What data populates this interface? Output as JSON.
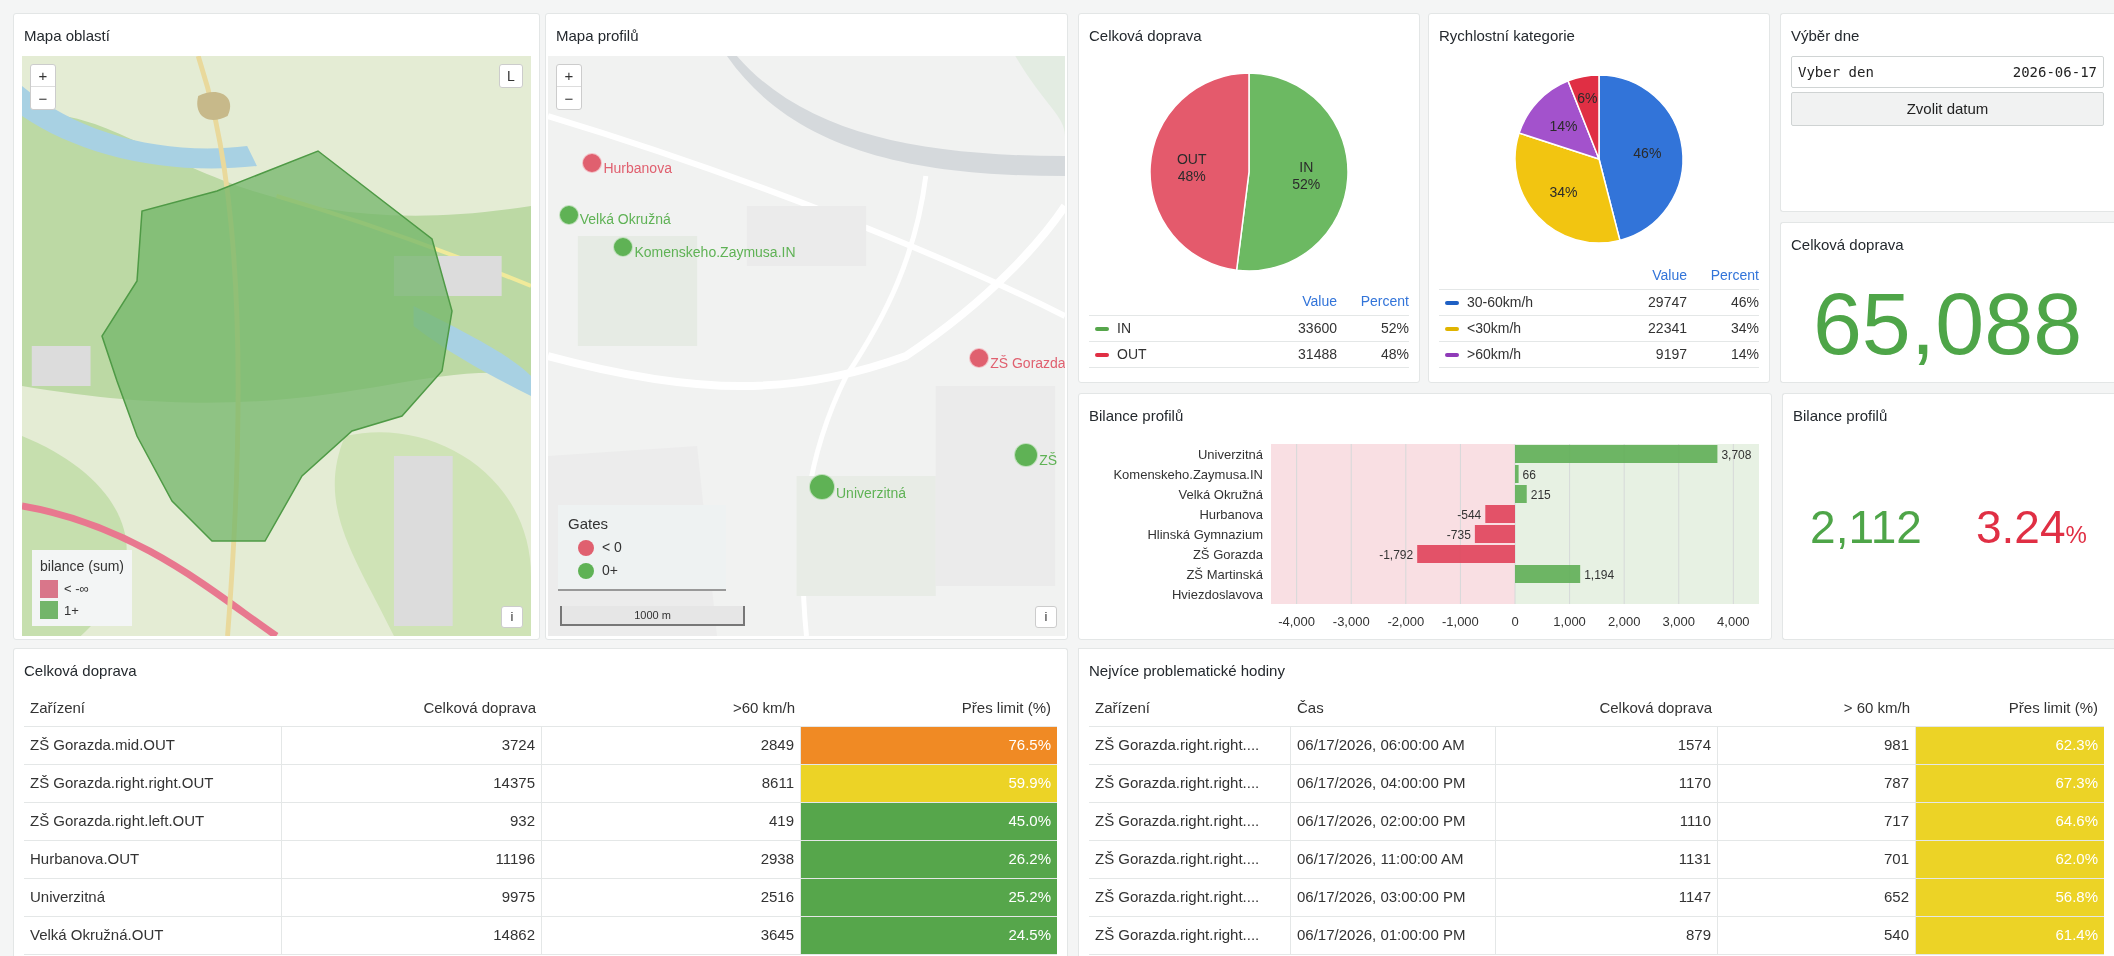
{
  "map_areas": {
    "title": "Mapa oblastí",
    "zoom_in": "+",
    "zoom_out": "−",
    "layers_button": "L",
    "info_button": "i",
    "legend": {
      "title": "bilance (sum)",
      "items": [
        {
          "label": "< -∞",
          "color": "#d9768a"
        },
        {
          "label": "1+",
          "color": "#73b56a"
        }
      ]
    }
  },
  "map_profiles": {
    "title": "Mapa profilů",
    "zoom_in": "+",
    "zoom_out": "−",
    "info_button": "i",
    "markers": [
      {
        "label": "Hurbanova",
        "color": "#e0606f"
      },
      {
        "label": "Velká Okružná",
        "color": "#5fb255"
      },
      {
        "label": "Komenskeho.Zaymusa.IN",
        "color": "#5fb255"
      },
      {
        "label": "ZŠ Gorazda",
        "color": "#e0606f"
      },
      {
        "label": "Univerzitná",
        "color": "#5fb255"
      },
      {
        "label": "ZŠ",
        "color": "#5fb255"
      }
    ],
    "legend": {
      "title": "Gates",
      "items": [
        {
          "label": "< 0",
          "color": "#e0606f"
        },
        {
          "label": "0+",
          "color": "#5fb255"
        }
      ]
    },
    "scale": "1000 m"
  },
  "traffic_pie": {
    "title": "Celková doprava",
    "chart_data": {
      "type": "pie",
      "categories": [
        "IN",
        "OUT"
      ],
      "values": [
        52,
        48
      ],
      "value_labels": [
        "52%",
        "48%"
      ],
      "colors": [
        "#6cb962",
        "#e45a6c"
      ]
    },
    "legend_columns": [
      "Value",
      "Percent"
    ],
    "legend_rows": [
      {
        "label": "IN",
        "color": "#56a64b",
        "value": "33600",
        "percent": "52%"
      },
      {
        "label": "OUT",
        "color": "#e02f44",
        "value": "31488",
        "percent": "48%"
      }
    ]
  },
  "speed_pie": {
    "title": "Rychlostní kategorie",
    "chart_data": {
      "type": "pie",
      "values": [
        46,
        34,
        14,
        6
      ],
      "value_labels": [
        "46%",
        "34%",
        "14%",
        "6%"
      ],
      "colors": [
        "#3274d9",
        "#f2c511",
        "#a352cc",
        "#e02f44"
      ]
    },
    "legend_columns": [
      "Value",
      "Percent"
    ],
    "legend_rows": [
      {
        "label": "30-60km/h",
        "color": "#1f60c4",
        "value": "29747",
        "percent": "46%"
      },
      {
        "label": "<30km/h",
        "color": "#e0b400",
        "value": "22341",
        "percent": "34%"
      },
      {
        "label": ">60km/h",
        "color": "#8f3bb8",
        "value": "9197",
        "percent": "14%"
      }
    ]
  },
  "day_picker": {
    "title": "Výběr dne",
    "field_label": "Vyber den",
    "value": "2026-06-17",
    "button": "Zvolit datum"
  },
  "total_stat": {
    "title": "Celková doprava",
    "value": "65,088"
  },
  "balance_chart": {
    "title": "Bilance profilů",
    "chart_data": {
      "type": "bar",
      "orientation": "horizontal",
      "categories": [
        "Univerzitná",
        "Komenskeho.Zaymusa.IN",
        "Velká Okružná",
        "Hurbanova",
        "Hlinská Gymnazium",
        "ZŠ Gorazda",
        "ZŠ Martinská",
        "Hviezdoslavova"
      ],
      "values": [
        3708,
        66,
        215,
        -544,
        -735,
        -1792,
        1194,
        null
      ],
      "value_labels": [
        "3,708",
        "66",
        "215",
        "-544",
        "-735",
        "-1,792",
        "1,194",
        null
      ],
      "xlim": [
        -4470,
        4470
      ],
      "grid": true,
      "xticks": [
        {
          "value": -4000,
          "label": "-4,000"
        },
        {
          "value": -3000,
          "label": "-3,000"
        },
        {
          "value": -2000,
          "label": "-2,000"
        },
        {
          "value": -1000,
          "label": "-1,000"
        },
        {
          "value": 0,
          "label": "0"
        },
        {
          "value": 1000,
          "label": "1,000"
        },
        {
          "value": 2000,
          "label": "2,000"
        },
        {
          "value": 3000,
          "label": "3,000"
        },
        {
          "value": 4000,
          "label": "4,000"
        }
      ]
    }
  },
  "balance_stat": {
    "title": "Bilance profilů",
    "value": "2,112",
    "percent": "3.24",
    "unit": "%"
  },
  "traffic_table": {
    "title": "Celková doprava",
    "columns": [
      "Zařízení",
      "Celková doprava",
      ">60 km/h",
      "Přes limit (%)"
    ],
    "rows": [
      {
        "cells": [
          "ZŠ Gorazda.mid.OUT",
          "3724",
          "2849",
          "76.5%"
        ],
        "color": "#f08a24"
      },
      {
        "cells": [
          "ZŠ Gorazda.right.right.OUT",
          "14375",
          "8611",
          "59.9%"
        ],
        "color": "#ecd326"
      },
      {
        "cells": [
          "ZŠ Gorazda.right.left.OUT",
          "932",
          "419",
          "45.0%"
        ],
        "color": "#56a64b"
      },
      {
        "cells": [
          "Hurbanova.OUT",
          "11196",
          "2938",
          "26.2%"
        ],
        "color": "#56a64b"
      },
      {
        "cells": [
          "Univerzitná",
          "9975",
          "2516",
          "25.2%"
        ],
        "color": "#56a64b"
      },
      {
        "cells": [
          "Velká Okružná.OUT",
          "14862",
          "3645",
          "24.5%"
        ],
        "color": "#56a64b"
      }
    ]
  },
  "problem_hours": {
    "title": "Nejvíce problematické hodiny",
    "columns": [
      "Zařízení",
      "Čas",
      "Celková doprava",
      "> 60 km/h",
      "Přes limit (%)"
    ],
    "rows": [
      {
        "cells": [
          "ZŠ Gorazda.right.right....",
          "06/17/2026, 06:00:00 AM",
          "1574",
          "981",
          "62.3%"
        ],
        "color": "#ecd326"
      },
      {
        "cells": [
          "ZŠ Gorazda.right.right....",
          "06/17/2026, 04:00:00 PM",
          "1170",
          "787",
          "67.3%"
        ],
        "color": "#ecd326"
      },
      {
        "cells": [
          "ZŠ Gorazda.right.right....",
          "06/17/2026, 02:00:00 PM",
          "1110",
          "717",
          "64.6%"
        ],
        "color": "#ecd326"
      },
      {
        "cells": [
          "ZŠ Gorazda.right.right....",
          "06/17/2026, 11:00:00 AM",
          "1131",
          "701",
          "62.0%"
        ],
        "color": "#ecd326"
      },
      {
        "cells": [
          "ZŠ Gorazda.right.right....",
          "06/17/2026, 03:00:00 PM",
          "1147",
          "652",
          "56.8%"
        ],
        "color": "#ecd326"
      },
      {
        "cells": [
          "ZŠ Gorazda.right.right....",
          "06/17/2026, 01:00:00 PM",
          "879",
          "540",
          "61.4%"
        ],
        "color": "#ecd326"
      }
    ]
  }
}
